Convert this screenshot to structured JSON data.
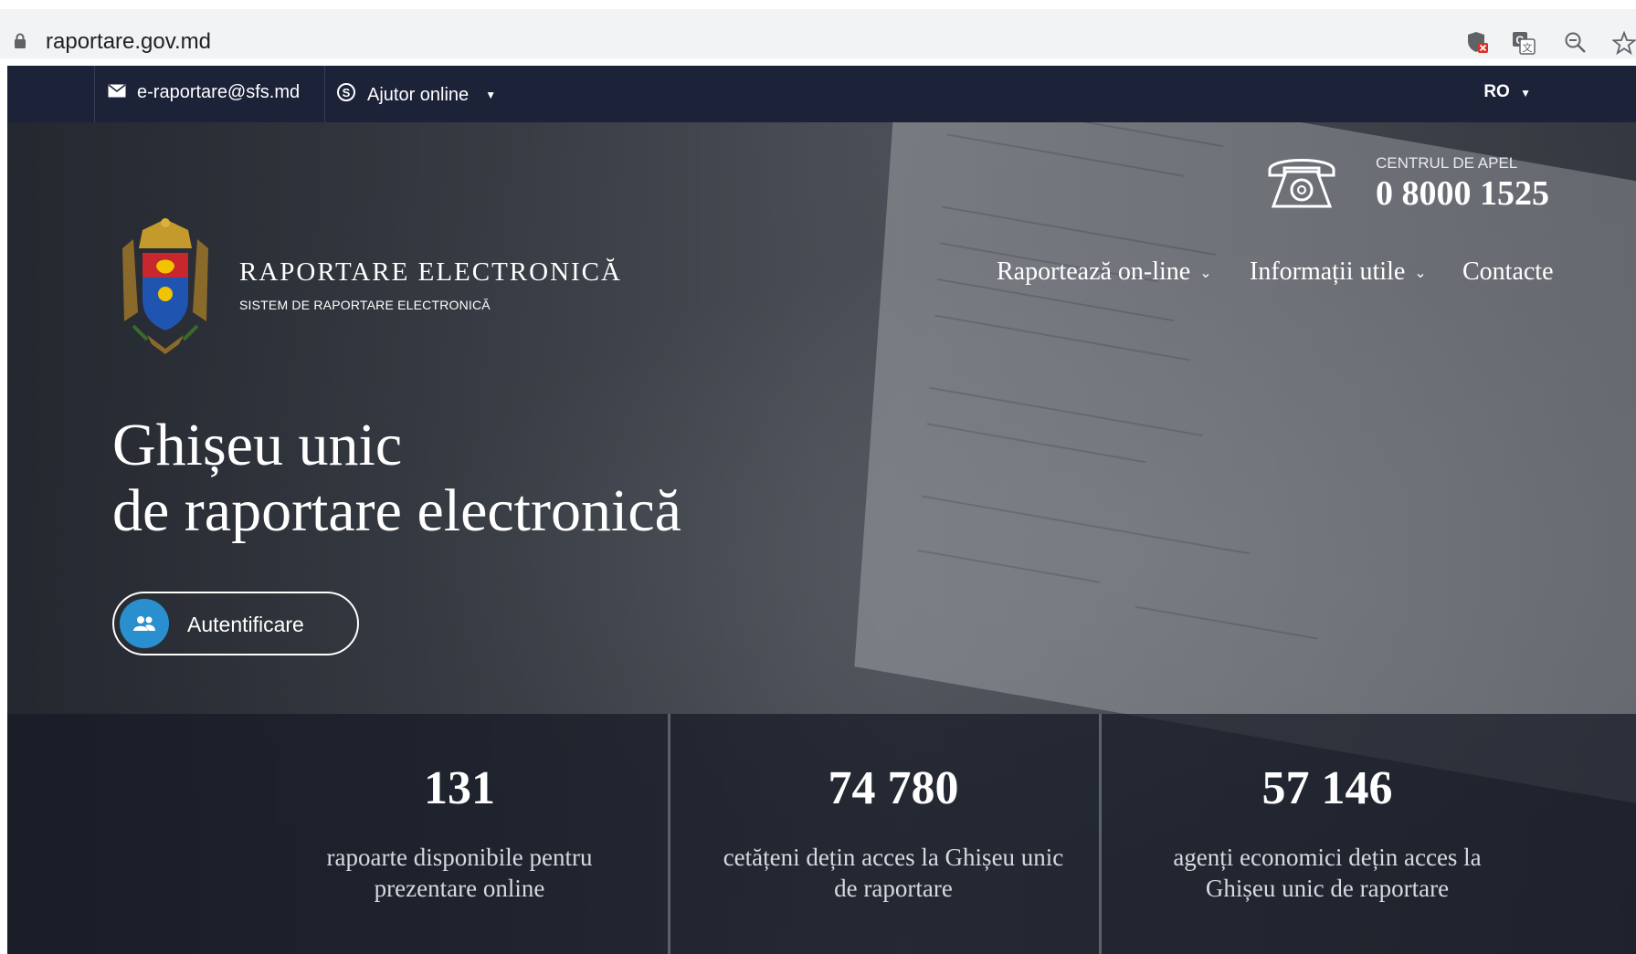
{
  "browser": {
    "url": "raportare.gov.md",
    "icons": [
      "lock-icon",
      "shield-blocked-icon",
      "translate-icon",
      "zoom-out-icon",
      "bookmark-star-icon"
    ]
  },
  "topbar": {
    "email": "e-raportare@sfs.md",
    "help": "Ajutor online",
    "language": "RO"
  },
  "brand": {
    "title": "RAPORTARE ELECTRONICĂ",
    "subtitle": "SISTEM DE RAPORTARE ELECTRONICĂ"
  },
  "callcenter": {
    "label": "CENTRUL DE APEL",
    "phone": "0 8000 1525"
  },
  "nav": {
    "items": [
      {
        "label": "Raportează on-line",
        "dropdown": true
      },
      {
        "label": "Informații utile",
        "dropdown": true
      },
      {
        "label": "Contacte",
        "dropdown": false
      }
    ]
  },
  "hero": {
    "line1": "Ghișeu unic",
    "line2": "de raportare electronică",
    "button": "Autentificare"
  },
  "stats": [
    {
      "number": "131",
      "line1": "rapoarte disponibile pentru",
      "line2": "prezentare online"
    },
    {
      "number": "74 780",
      "line1": "cetățeni dețin acces la Ghișeu unic",
      "line2": "de raportare"
    },
    {
      "number": "57 146",
      "line1": "agenți economici dețin acces la",
      "line2": "Ghișeu unic de raportare"
    }
  ],
  "colors": {
    "topbar": "#1c2238",
    "accent": "#2a8fce"
  }
}
